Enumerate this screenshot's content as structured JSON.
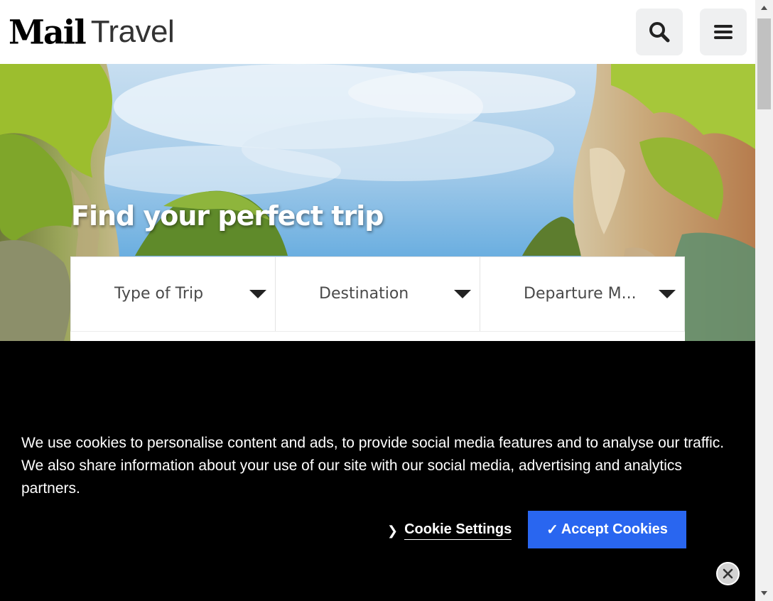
{
  "header": {
    "logo_mail": "Mail",
    "logo_travel": "Travel",
    "search_icon": "search-icon",
    "menu_icon": "hamburger-menu-icon"
  },
  "hero": {
    "title": "Find your perfect trip"
  },
  "filters": [
    {
      "label": "Type of Trip",
      "icon": "caret-down-icon"
    },
    {
      "label": "Destination",
      "icon": "caret-down-icon"
    },
    {
      "label": "Departure M...",
      "icon": "caret-down-icon"
    }
  ],
  "cookie_banner": {
    "message": "We use cookies to personalise content and ads, to provide social media features and to analyse our traffic. We also share information about your use of our site with our social media, advertising and analytics partners.",
    "settings_label": "Cookie Settings",
    "accept_check": "✓",
    "accept_label": "Accept Cookies",
    "close_icon": "close-icon"
  },
  "colors": {
    "accept_button": "#2966f0",
    "banner_bg": "#000000",
    "header_button_bg": "#eff0f1"
  }
}
